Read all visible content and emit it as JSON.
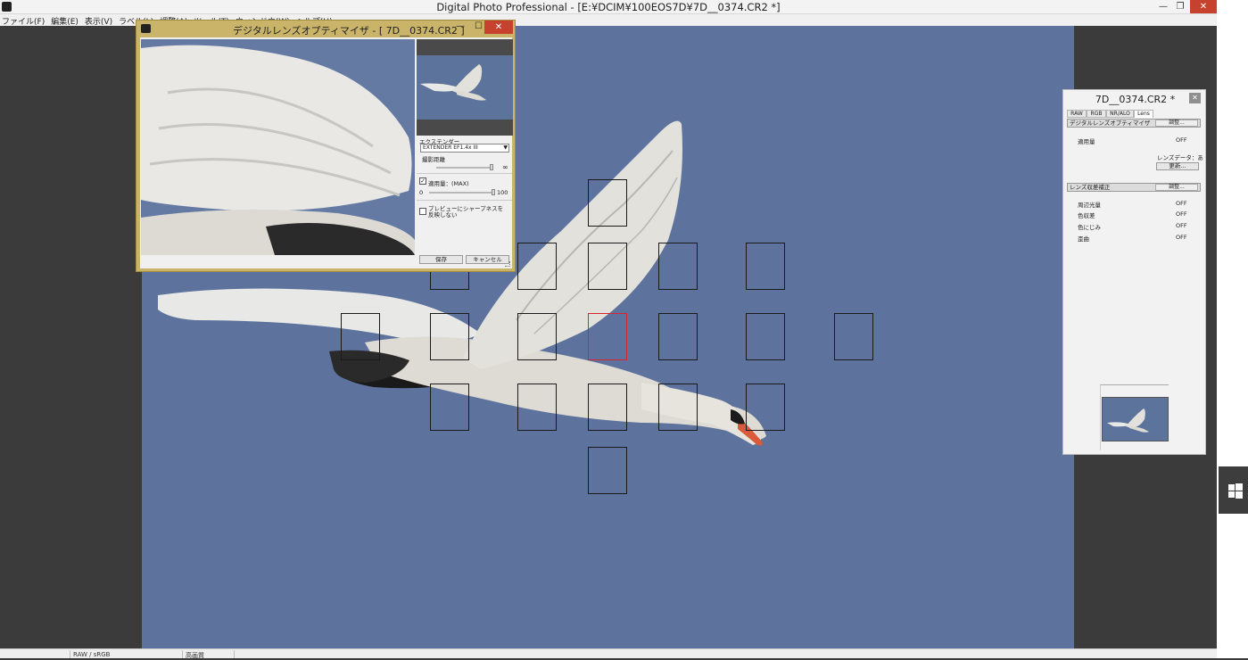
{
  "window": {
    "title": "Digital Photo Professional - [E:¥DCIM¥100EOS7D¥7D__0374.CR2 *]",
    "min": "—",
    "restore": "❐",
    "close": "✕"
  },
  "menu": [
    "ファイル(F)",
    "編集(E)",
    "表示(V)",
    "ラベル(L)",
    "調整(A)",
    "ツール(T)",
    "ウィンドウ(W)",
    "ヘルプ(H)"
  ],
  "dialog": {
    "title": "デジタルレンズオプティマイザ - [ 7D__0374.CR2 ]",
    "minimize": "—",
    "maximize": "☐",
    "close": "✕",
    "extender_label": "エクステンダー",
    "extender_value": "EXTENDER EF1.4x III",
    "distance_label": "撮影距離",
    "infinity": "∞",
    "amount_checked": true,
    "amount_label": "適用量：(MAX)",
    "amount_min": "0",
    "amount_max": "100",
    "amount_value": 100,
    "sharpness_label": "プレビューにシャープネスを反映しない",
    "save_button": "保存",
    "cancel_button": "キャンセル"
  },
  "palette": {
    "title": "7D__0374.CR2 *",
    "close": "✕",
    "tabs": [
      "RAW",
      "RGB",
      "NR/ALO",
      "Lens"
    ],
    "active_tab": "Lens",
    "dlo_section": "デジタルレンズオプティマイザ",
    "adjust_button": "調整...",
    "amount_label": "適用量",
    "amount_value": "OFF",
    "lens_data_label": "レンズデータ：あり",
    "update_button": "更新...",
    "aberration_section": "レンズ収差補正",
    "aberration_adjust_button": "調整...",
    "rows": [
      {
        "label": "周辺光量",
        "value": "OFF"
      },
      {
        "label": "色収差",
        "value": "OFF"
      },
      {
        "label": "色にじみ",
        "value": "OFF"
      },
      {
        "label": "歪曲",
        "value": "OFF"
      }
    ]
  },
  "status": {
    "color_space": "RAW / sRGB",
    "quality": "高画質"
  },
  "colors": {
    "sky": "#5d739d",
    "af_selected": "#d7262b",
    "dialog_frame": "#c9b46a"
  }
}
